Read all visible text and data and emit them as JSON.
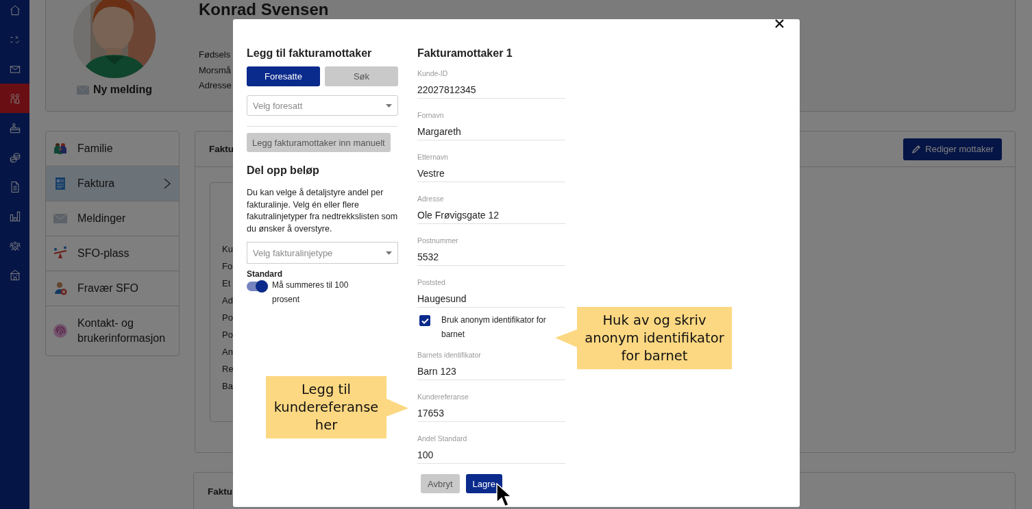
{
  "rail": [
    {
      "selected": false
    },
    {
      "selected": false
    },
    {
      "selected": false
    },
    {
      "selected": true
    },
    {
      "selected": false
    },
    {
      "selected": false
    },
    {
      "selected": false
    },
    {
      "selected": false
    },
    {
      "selected": false
    },
    {
      "selected": false
    }
  ],
  "profile": {
    "message_link": "Ny melding",
    "name": "Konrad Svensen",
    "info_labels": [
      "Fødsels",
      "Morsmå",
      "Adresse"
    ]
  },
  "menu": [
    {
      "label": "Familie",
      "selected": false
    },
    {
      "label": "Faktura",
      "selected": true
    },
    {
      "label": "Meldinger",
      "selected": false
    },
    {
      "label": "SFO-plass",
      "selected": false
    },
    {
      "label": "Fravær SFO",
      "selected": false
    },
    {
      "label": "Kontakt- og brukerinformasjon",
      "selected": false
    }
  ],
  "invoice_panel": {
    "title": "Faktu",
    "edit_button": "Rediger mottaker",
    "labels": [
      "Ku",
      "Fo",
      "Et",
      "Ad",
      "Po",
      "Po",
      "An",
      "Re",
      "Ba"
    ]
  },
  "second_panel": {
    "title": "Faktu"
  },
  "modal": {
    "add_recipient": {
      "title": "Legg til fakturamottaker",
      "tabs": [
        {
          "label": "Foresatte",
          "selected": true
        },
        {
          "label": "Søk",
          "selected": false
        }
      ],
      "guardian_select": {
        "placeholder": "Velg foresatt"
      },
      "manual_button": "Legg fakturamottaker inn manuelt"
    },
    "split": {
      "title": "Del opp beløp",
      "description": "Du kan velge å detaljstyre andel per fakturalinje. Velg én eller flere fakutralinjetyper fra nedtrekkslisten som du ønsker å overstyre.",
      "line_type_select": {
        "placeholder": "Velg fakturalinjetype"
      },
      "toggle": {
        "label": "Standard",
        "on": true,
        "text": "Må summeres til 100 prosent"
      }
    },
    "recipient": {
      "title": "Fakturamottaker 1",
      "fields": [
        {
          "kind": "text",
          "label": "Kunde-ID",
          "value": "22027812345"
        },
        {
          "kind": "text",
          "label": "Fornavn",
          "value": "Margareth"
        },
        {
          "kind": "text",
          "label": "Etternavn",
          "value": "Vestre"
        },
        {
          "kind": "text",
          "label": "Adresse",
          "value": "Ole Frøvigsgate 12"
        },
        {
          "kind": "text",
          "label": "Postnummer",
          "value": "5532"
        },
        {
          "kind": "text",
          "label": "Poststed",
          "value": "Haugesund"
        },
        {
          "kind": "checkbox",
          "label": "Bruk anonym identifikator for barnet",
          "checked": true
        },
        {
          "kind": "text",
          "label": "Barnets identifikator",
          "value": "Barn 123"
        },
        {
          "kind": "text",
          "label": "Kundereferanse",
          "value": "17653"
        },
        {
          "kind": "text",
          "label": "Andel Standard",
          "value": "100"
        }
      ]
    },
    "buttons": [
      {
        "label": "Avbryt",
        "kind": "secondary"
      },
      {
        "label": "Lagre",
        "kind": "primary"
      }
    ]
  },
  "callouts": [
    {
      "text": "Huk av og skriv anonym identifikator for barnet"
    },
    {
      "text": "Legg til kundereferanse her"
    }
  ]
}
